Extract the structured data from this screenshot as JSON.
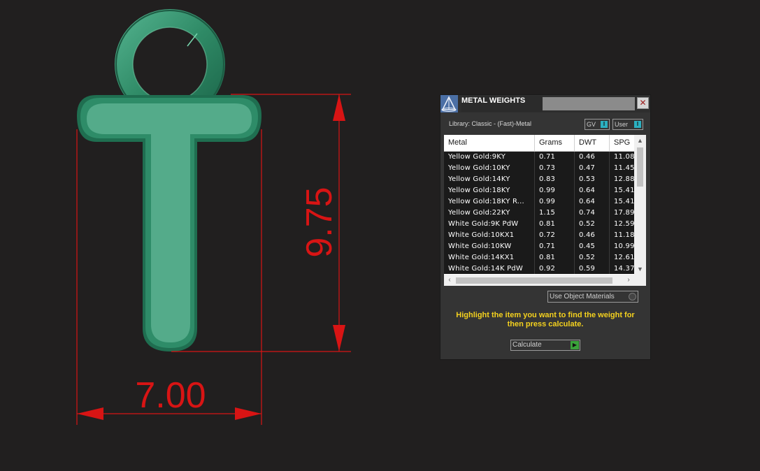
{
  "viewport": {
    "dimension_width": "7.00",
    "dimension_height": "9.75",
    "colors": {
      "background": "#211f1f",
      "dimension": "#d81414",
      "model": "#3a9d78"
    }
  },
  "panel": {
    "title": "METAL WEIGHTS",
    "close_label": "✕",
    "library_label": "Library: Classic - (Fast)-Metal",
    "toggle_gv": "GV",
    "toggle_user": "User",
    "table": {
      "columns": [
        "Metal",
        "Grams",
        "DWT",
        "SPG"
      ],
      "rows": [
        [
          "Yellow Gold:9KY",
          "0.71",
          "0.46",
          "11.08"
        ],
        [
          "Yellow Gold:10KY",
          "0.73",
          "0.47",
          "11.45"
        ],
        [
          "Yellow Gold:14KY",
          "0.83",
          "0.53",
          "12.88"
        ],
        [
          "Yellow Gold:18KY",
          "0.99",
          "0.64",
          "15.41"
        ],
        [
          "Yellow Gold:18KY R...",
          "0.99",
          "0.64",
          "15.41"
        ],
        [
          "Yellow Gold:22KY",
          "1.15",
          "0.74",
          "17.89"
        ],
        [
          "White Gold:9K PdW",
          "0.81",
          "0.52",
          "12.59"
        ],
        [
          "White Gold:10KX1",
          "0.72",
          "0.46",
          "11.18"
        ],
        [
          "White Gold:10KW",
          "0.71",
          "0.45",
          "10.99"
        ],
        [
          "White Gold:14KX1",
          "0.81",
          "0.52",
          "12.61"
        ],
        [
          "White Gold:14K PdW",
          "0.92",
          "0.59",
          "14.37"
        ]
      ]
    },
    "use_object_materials": "Use Object Materials",
    "hint": "Highlight the item you want to find the weight for then press calculate.",
    "calculate_label": "Calculate"
  }
}
